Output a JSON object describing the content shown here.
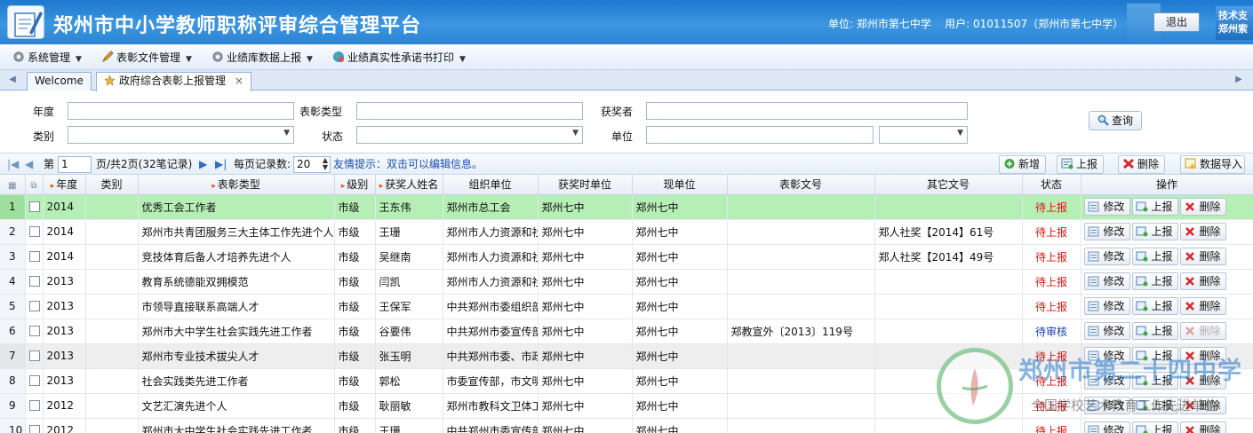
{
  "header": {
    "title": "郑州市中小学教师职称评审综合管理平台",
    "unit_label": "单位:",
    "unit_value": "郑州市第七中学",
    "user_label": "用户:",
    "user_value": "01011507（郑州市第七中学）",
    "logout": "退出",
    "support_line1": "技术支",
    "support_line2": "郑州索"
  },
  "menu": {
    "items": [
      {
        "label": "系统管理"
      },
      {
        "label": "表彰文件管理"
      },
      {
        "label": "业绩库数据上报"
      },
      {
        "label": "业绩真实性承诺书打印"
      }
    ]
  },
  "tabs": [
    {
      "label": "Welcome"
    },
    {
      "label": "政府综合表彰上报管理",
      "close": "×"
    }
  ],
  "filters": {
    "year": "年度",
    "award_type": "表彰类型",
    "winner": "获奖者",
    "category": "类别",
    "status": "状态",
    "unit": "单位",
    "query": "查询"
  },
  "pager": {
    "page_label": "第",
    "page_value": "1",
    "page_info": "页/共2页(32笔记录)",
    "per_page_label": "每页记录数:",
    "per_page_value": "20",
    "hint": "友情提示：双击可以编辑信息。",
    "btn_add": "新增",
    "btn_report": "上报",
    "btn_delete": "删除",
    "btn_import": "数据导入"
  },
  "columns": [
    "年度",
    "类别",
    "表彰类型",
    "级别",
    "获奖人姓名",
    "组织单位",
    "获奖时单位",
    "现单位",
    "表彰文号",
    "其它文号",
    "状态",
    "操作"
  ],
  "row_actions": {
    "edit": "修改",
    "report": "上报",
    "delete": "删除"
  },
  "rows": [
    {
      "n": "1",
      "year": "2014",
      "cat": "",
      "type": "优秀工会工作者",
      "level": "市级",
      "name": "王东伟",
      "org": "郑州市总工会",
      "award_unit": "郑州七中",
      "cur_unit": "郑州七中",
      "doc": "",
      "other_doc": "",
      "status": "待上报",
      "status_color": "red"
    },
    {
      "n": "2",
      "year": "2014",
      "cat": "",
      "type": "郑州市共青团服务三大主体工作先进个人",
      "level": "市级",
      "name": "王珊",
      "org": "郑州市人力资源和社",
      "award_unit": "郑州七中",
      "cur_unit": "郑州七中",
      "doc": "",
      "other_doc": "郑人社奖【2014】61号",
      "status": "待上报",
      "status_color": "red"
    },
    {
      "n": "3",
      "year": "2014",
      "cat": "",
      "type": "竞技体育后备人才培养先进个人",
      "level": "市级",
      "name": "吴继南",
      "org": "郑州市人力资源和社",
      "award_unit": "郑州七中",
      "cur_unit": "郑州七中",
      "doc": "",
      "other_doc": "郑人社奖【2014】49号",
      "status": "待上报",
      "status_color": "red"
    },
    {
      "n": "4",
      "year": "2013",
      "cat": "",
      "type": "教育系统德能双拥模范",
      "level": "市级",
      "name": "闫凯",
      "org": "郑州市人力资源和社",
      "award_unit": "郑州七中",
      "cur_unit": "郑州七中",
      "doc": "",
      "other_doc": "",
      "status": "待上报",
      "status_color": "red"
    },
    {
      "n": "5",
      "year": "2013",
      "cat": "",
      "type": "市领导直接联系高端人才",
      "level": "市级",
      "name": "王保军",
      "org": "中共郑州市委组织部",
      "award_unit": "郑州七中",
      "cur_unit": "郑州七中",
      "doc": "",
      "other_doc": "",
      "status": "待上报",
      "status_color": "red"
    },
    {
      "n": "6",
      "year": "2013",
      "cat": "",
      "type": "郑州市大中学生社会实践先进工作者",
      "level": "市级",
      "name": "谷要伟",
      "org": "中共郑州市委宣传部",
      "award_unit": "郑州七中",
      "cur_unit": "郑州七中",
      "doc": "郑教宣外〔2013〕119号",
      "other_doc": "",
      "status": "待审核",
      "status_color": "blue"
    },
    {
      "n": "7",
      "year": "2013",
      "cat": "",
      "type": "郑州市专业技术拔尖人才",
      "level": "市级",
      "name": "张玉明",
      "org": "中共郑州市委、市政",
      "award_unit": "郑州七中",
      "cur_unit": "郑州七中",
      "doc": "",
      "other_doc": "",
      "status": "待上报",
      "status_color": "red"
    },
    {
      "n": "8",
      "year": "2013",
      "cat": "",
      "type": "社会实践类先进工作者",
      "level": "市级",
      "name": "郭松",
      "org": "市委宣传部，市文明",
      "award_unit": "郑州七中",
      "cur_unit": "郑州七中",
      "doc": "",
      "other_doc": "",
      "status": "待上报",
      "status_color": "red"
    },
    {
      "n": "9",
      "year": "2012",
      "cat": "",
      "type": "文艺汇演先进个人",
      "level": "市级",
      "name": "耿丽敏",
      "org": "郑州市教科文卫体工",
      "award_unit": "郑州七中",
      "cur_unit": "郑州七中",
      "doc": "",
      "other_doc": "",
      "status": "待上报",
      "status_color": "red"
    },
    {
      "n": "10",
      "year": "2012",
      "cat": "",
      "type": "郑州市大中学生社会实践先进工作者",
      "level": "市级",
      "name": "王珊",
      "org": "中共郑州市委宣传部",
      "award_unit": "郑州七中",
      "cur_unit": "郑州七中",
      "doc": "",
      "other_doc": "",
      "status": "待上报",
      "status_color": "red"
    }
  ],
  "watermark": {
    "name": "郑州市第二十四中学",
    "sub": "全国学校艺术教育工作先进单位"
  }
}
